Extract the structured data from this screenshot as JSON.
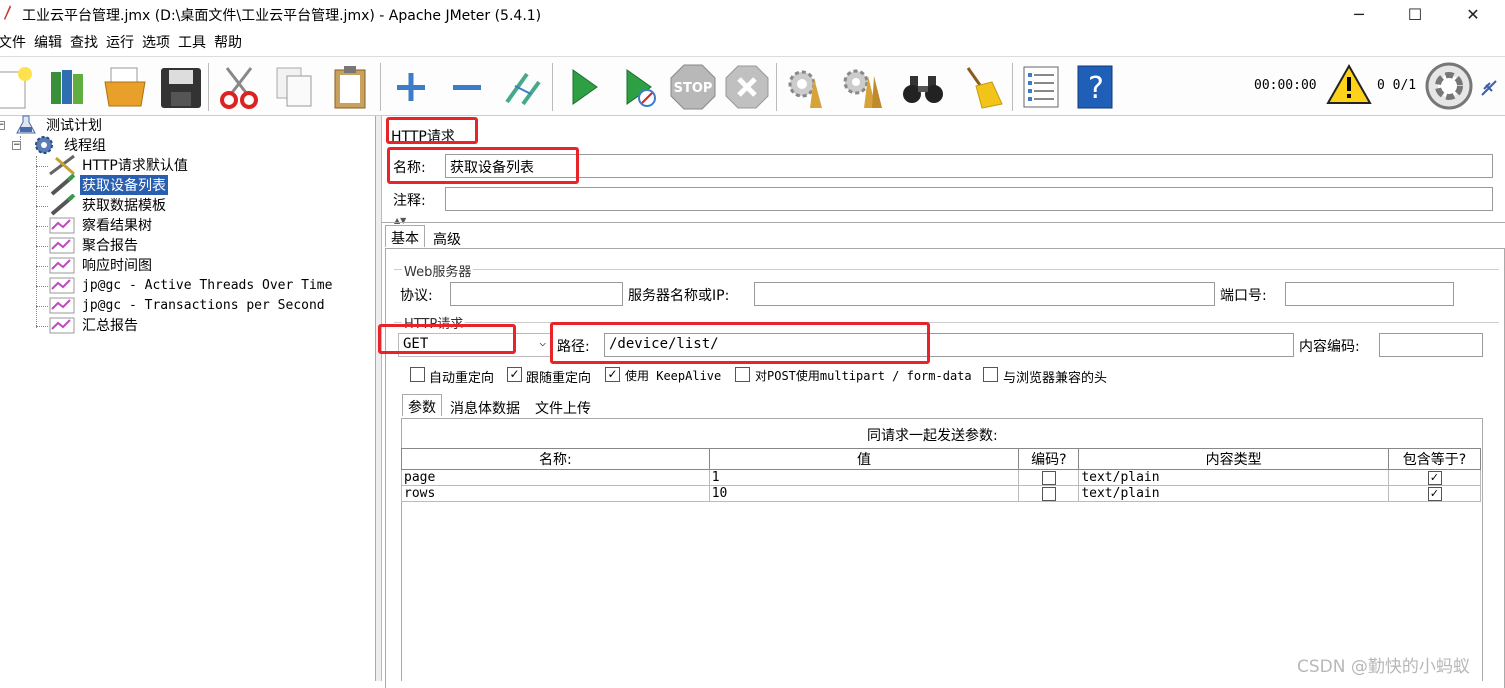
{
  "window": {
    "title": "工业云平台管理.jmx (D:\\桌面文件\\工业云平台管理.jmx) - Apache JMeter (5.4.1)",
    "minimize": "─",
    "maximize": "☐",
    "close": "✕"
  },
  "menu": [
    "文件",
    "编辑",
    "查找",
    "运行",
    "选项",
    "工具",
    "帮助"
  ],
  "toolbar": {
    "timer": "00:00:00",
    "counts": "0  0/1"
  },
  "tree": {
    "root": "测试计划",
    "thread_group": "线程组",
    "items": [
      "HTTP请求默认值",
      "获取设备列表",
      "获取数据模板",
      "察看结果树",
      "聚合报告",
      "响应时间图",
      "jp@gc - Active Threads Over Time",
      "jp@gc - Transactions per Second",
      "汇总报告"
    ]
  },
  "panel": {
    "heading": "HTTP请求",
    "name_label": "名称:",
    "name_value": "获取设备列表",
    "comment_label": "注释:",
    "comment_value": "",
    "tabs": [
      "基本",
      "高级"
    ],
    "web_server": {
      "title": "Web服务器",
      "protocol_label": "协议:",
      "protocol_value": "",
      "server_label": "服务器名称或IP:",
      "server_value": "",
      "port_label": "端口号:",
      "port_value": ""
    },
    "http_request": {
      "title": "HTTP请求",
      "method": "GET",
      "path_label": "路径:",
      "path_value": "/device/list/",
      "encoding_label": "内容编码:",
      "encoding_value": ""
    },
    "options": [
      {
        "label": "自动重定向",
        "checked": false
      },
      {
        "label": "跟随重定向",
        "checked": true
      },
      {
        "label": "使用 KeepAlive",
        "checked": true
      },
      {
        "label": "对POST使用multipart / form-data",
        "checked": false
      },
      {
        "label": "与浏览器兼容的头",
        "checked": false
      }
    ],
    "sub_tabs": [
      "参数",
      "消息体数据",
      "文件上传"
    ],
    "params_caption": "同请求一起发送参数:",
    "params_headers": [
      "名称:",
      "值",
      "编码?",
      "内容类型",
      "包含等于?"
    ],
    "params_rows": [
      {
        "name": "page",
        "value": "1",
        "encode": false,
        "content_type": "text/plain",
        "include_equals": true
      },
      {
        "name": "rows",
        "value": "10",
        "encode": false,
        "content_type": "text/plain",
        "include_equals": true
      }
    ]
  },
  "watermark": "CSDN @勤快的小蚂蚁",
  "colors": {
    "highlight_red": "#e8232a",
    "selection_blue": "#2a5fb0",
    "run_green": "#2ea043"
  }
}
